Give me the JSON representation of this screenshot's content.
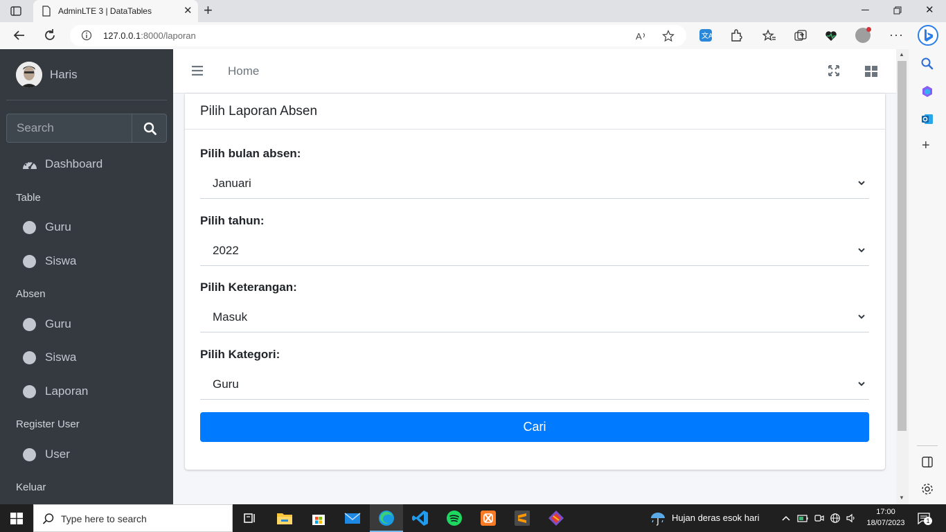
{
  "browser": {
    "tab_title": "AdminLTE 3 | DataTables",
    "url_host": "127.0.0.1",
    "url_path": ":8000/laporan"
  },
  "sidebar": {
    "user_name": "Haris",
    "search_placeholder": "Search",
    "dashboard": "Dashboard",
    "sections": [
      {
        "header": "Table",
        "items": [
          "Guru",
          "Siswa"
        ]
      },
      {
        "header": "Absen",
        "items": [
          "Guru",
          "Siswa",
          "Laporan"
        ]
      },
      {
        "header": "Register User",
        "items": [
          "User"
        ]
      },
      {
        "header": "Keluar",
        "items": []
      }
    ]
  },
  "navbar": {
    "home": "Home"
  },
  "card": {
    "title": "Pilih Laporan Absen",
    "fields": [
      {
        "label": "Pilih bulan absen:",
        "value": "Januari"
      },
      {
        "label": "Pilih tahun:",
        "value": "2022"
      },
      {
        "label": "Pilih Keterangan:",
        "value": "Masuk"
      },
      {
        "label": "Pilih Kategori:",
        "value": "Guru"
      }
    ],
    "submit": "Cari"
  },
  "taskbar": {
    "search_placeholder": "Type here to search",
    "weather": "Hujan deras esok hari",
    "time": "17:00",
    "date": "18/07/2023",
    "notifications": "1"
  },
  "colors": {
    "sidebar_bg": "#343a40",
    "primary": "#007bff",
    "content_bg": "#f4f6f9"
  }
}
